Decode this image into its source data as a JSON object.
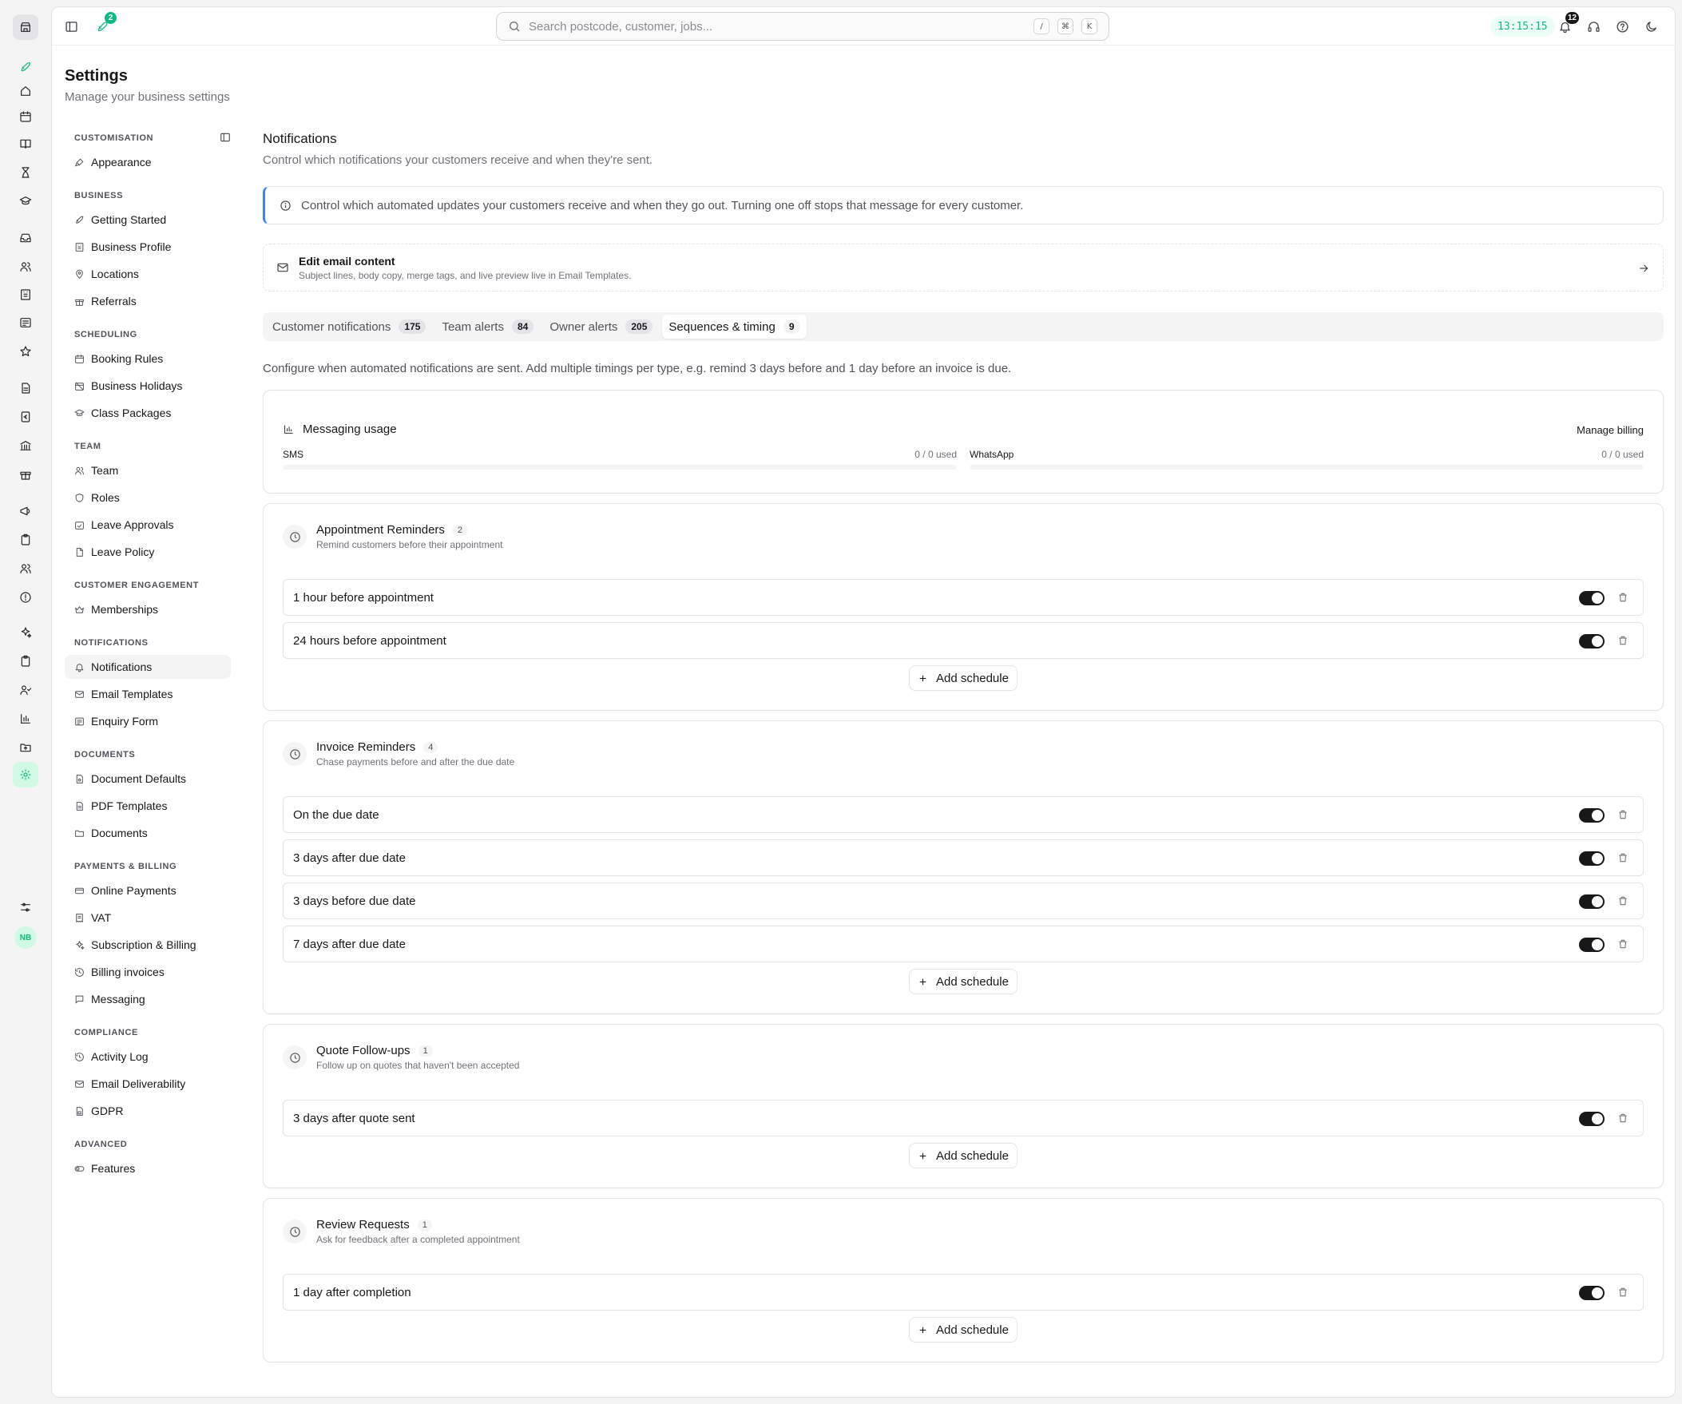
{
  "topbar": {
    "search_placeholder": "Search postcode, customer, jobs...",
    "kbd": [
      "/",
      "⌘",
      "K"
    ],
    "rocket_badge": "2",
    "clock": "13:15:15",
    "notif_badge": "12"
  },
  "rail": {
    "avatar_initials": "NB"
  },
  "page": {
    "title": "Settings",
    "subtitle": "Manage your business settings"
  },
  "nav": {
    "groups": [
      {
        "title": "CUSTOMISATION",
        "items": [
          {
            "label": "Appearance",
            "icon": "brush-icon"
          }
        ]
      },
      {
        "title": "BUSINESS",
        "items": [
          {
            "label": "Getting Started",
            "icon": "rocket-icon"
          },
          {
            "label": "Business Profile",
            "icon": "building-icon"
          },
          {
            "label": "Locations",
            "icon": "map-pin-icon"
          },
          {
            "label": "Referrals",
            "icon": "gift-icon"
          }
        ]
      },
      {
        "title": "SCHEDULING",
        "items": [
          {
            "label": "Booking Rules",
            "icon": "calendar-icon"
          },
          {
            "label": "Business Holidays",
            "icon": "calendar-off-icon"
          },
          {
            "label": "Class Packages",
            "icon": "graduation-icon"
          }
        ]
      },
      {
        "title": "TEAM",
        "items": [
          {
            "label": "Team",
            "icon": "users-icon"
          },
          {
            "label": "Roles",
            "icon": "shield-icon"
          },
          {
            "label": "Leave Approvals",
            "icon": "calendar-check-icon"
          },
          {
            "label": "Leave Policy",
            "icon": "file-icon"
          }
        ]
      },
      {
        "title": "CUSTOMER ENGAGEMENT",
        "items": [
          {
            "label": "Memberships",
            "icon": "crown-icon"
          }
        ]
      },
      {
        "title": "NOTIFICATIONS",
        "items": [
          {
            "label": "Notifications",
            "icon": "bell-icon",
            "active": true
          },
          {
            "label": "Email Templates",
            "icon": "mail-icon"
          },
          {
            "label": "Enquiry Form",
            "icon": "form-icon"
          }
        ]
      },
      {
        "title": "DOCUMENTS",
        "items": [
          {
            "label": "Document Defaults",
            "icon": "file-cog-icon"
          },
          {
            "label": "PDF Templates",
            "icon": "file-text-icon"
          },
          {
            "label": "Documents",
            "icon": "folder-icon"
          }
        ]
      },
      {
        "title": "PAYMENTS & BILLING",
        "items": [
          {
            "label": "Online Payments",
            "icon": "credit-card-icon"
          },
          {
            "label": "VAT",
            "icon": "receipt-icon"
          },
          {
            "label": "Subscription & Billing",
            "icon": "sparkles-icon"
          },
          {
            "label": "Billing invoices",
            "icon": "history-icon"
          },
          {
            "label": "Messaging",
            "icon": "message-icon"
          }
        ]
      },
      {
        "title": "COMPLIANCE",
        "items": [
          {
            "label": "Activity Log",
            "icon": "history-icon"
          },
          {
            "label": "Email Deliverability",
            "icon": "mail-check-icon"
          },
          {
            "label": "GDPR",
            "icon": "file-lock-icon"
          }
        ]
      },
      {
        "title": "ADVANCED",
        "items": [
          {
            "label": "Features",
            "icon": "toggle-icon"
          }
        ]
      }
    ]
  },
  "content": {
    "title": "Notifications",
    "subtitle": "Control which notifications your customers receive and when they're sent.",
    "info": "Control which automated updates your customers receive and when they go out. Turning one off stops that message for every customer.",
    "edit_email": {
      "title": "Edit email content",
      "subtitle": "Subject lines, body copy, merge tags, and live preview live in Email Templates."
    },
    "tabs": [
      {
        "label": "Customer notifications",
        "count": "175"
      },
      {
        "label": "Team alerts",
        "count": "84"
      },
      {
        "label": "Owner alerts",
        "count": "205"
      },
      {
        "label": "Sequences & timing",
        "count": "9",
        "active": true
      }
    ],
    "config_text": "Configure when automated notifications are sent. Add multiple timings per type, e.g. remind 3 days before and 1 day before an invoice is due.",
    "usage": {
      "title": "Messaging usage",
      "manage_billing": "Manage billing",
      "meters": [
        {
          "label": "SMS",
          "used": "0 / 0 used",
          "fraction": 0
        },
        {
          "label": "WhatsApp",
          "used": "0 / 0 used",
          "fraction": 0
        }
      ]
    },
    "add_label": "Add schedule",
    "sequences": [
      {
        "title": "Appointment Reminders",
        "count": "2",
        "subtitle": "Remind customers before their appointment",
        "rows": [
          "1 hour before appointment",
          "24 hours before appointment"
        ]
      },
      {
        "title": "Invoice Reminders",
        "count": "4",
        "subtitle": "Chase payments before and after the due date",
        "rows": [
          "On the due date",
          "3 days after due date",
          "3 days before due date",
          "7 days after due date"
        ]
      },
      {
        "title": "Quote Follow-ups",
        "count": "1",
        "subtitle": "Follow up on quotes that haven't been accepted",
        "rows": [
          "3 days after quote sent"
        ]
      },
      {
        "title": "Review Requests",
        "count": "1",
        "subtitle": "Ask for feedback after a completed appointment",
        "rows": [
          "1 day after completion"
        ]
      }
    ]
  }
}
